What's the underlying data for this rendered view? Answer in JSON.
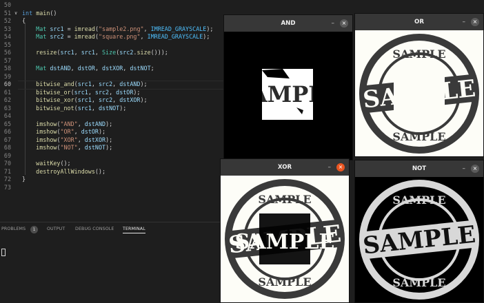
{
  "editor": {
    "lines": [
      {
        "n": "50",
        "parts": []
      },
      {
        "n": "51",
        "fold": "∨",
        "parts": [
          {
            "t": "int",
            "c": "kw"
          },
          {
            "t": " "
          },
          {
            "t": "main",
            "c": "fn"
          },
          {
            "t": "()"
          }
        ]
      },
      {
        "n": "52",
        "parts": [
          {
            "t": "{"
          }
        ]
      },
      {
        "n": "53",
        "parts": [
          {
            "t": "    "
          },
          {
            "t": "Mat",
            "c": "ty"
          },
          {
            "t": " "
          },
          {
            "t": "src1",
            "c": "pm"
          },
          {
            "t": " = "
          },
          {
            "t": "imread",
            "c": "fn"
          },
          {
            "t": "("
          },
          {
            "t": "\"sample2.png\"",
            "c": "st"
          },
          {
            "t": ", "
          },
          {
            "t": "IMREAD_GRAYSCALE",
            "c": "cn"
          },
          {
            "t": ");"
          }
        ]
      },
      {
        "n": "54",
        "parts": [
          {
            "t": "    "
          },
          {
            "t": "Mat",
            "c": "ty"
          },
          {
            "t": " "
          },
          {
            "t": "src2",
            "c": "pm"
          },
          {
            "t": " = "
          },
          {
            "t": "imread",
            "c": "fn"
          },
          {
            "t": "("
          },
          {
            "t": "\"square.png\"",
            "c": "st"
          },
          {
            "t": ", "
          },
          {
            "t": "IMREAD_GRAYSCALE",
            "c": "cn"
          },
          {
            "t": ");"
          }
        ]
      },
      {
        "n": "55",
        "parts": []
      },
      {
        "n": "56",
        "parts": [
          {
            "t": "    "
          },
          {
            "t": "resize",
            "c": "fn"
          },
          {
            "t": "("
          },
          {
            "t": "src1",
            "c": "pm"
          },
          {
            "t": ", "
          },
          {
            "t": "src1",
            "c": "pm"
          },
          {
            "t": ", "
          },
          {
            "t": "Size",
            "c": "ty"
          },
          {
            "t": "("
          },
          {
            "t": "src2",
            "c": "pm"
          },
          {
            "t": "."
          },
          {
            "t": "size",
            "c": "fn"
          },
          {
            "t": "()));"
          }
        ]
      },
      {
        "n": "57",
        "parts": []
      },
      {
        "n": "58",
        "parts": [
          {
            "t": "    "
          },
          {
            "t": "Mat",
            "c": "ty"
          },
          {
            "t": " "
          },
          {
            "t": "dstAND",
            "c": "pm"
          },
          {
            "t": ", "
          },
          {
            "t": "dstOR",
            "c": "pm"
          },
          {
            "t": ", "
          },
          {
            "t": "dstXOR",
            "c": "pm"
          },
          {
            "t": ", "
          },
          {
            "t": "dstNOT",
            "c": "pm"
          },
          {
            "t": ";"
          }
        ]
      },
      {
        "n": "59",
        "parts": []
      },
      {
        "n": "60",
        "cur": true,
        "parts": [
          {
            "t": "    "
          },
          {
            "t": "bitwise_and",
            "c": "fn"
          },
          {
            "t": "("
          },
          {
            "t": "src1",
            "c": "pm"
          },
          {
            "t": ", "
          },
          {
            "t": "src2",
            "c": "pm"
          },
          {
            "t": ", "
          },
          {
            "t": "dstAND",
            "c": "pm"
          },
          {
            "t": ");"
          }
        ]
      },
      {
        "n": "61",
        "parts": [
          {
            "t": "    "
          },
          {
            "t": "bitwise_or",
            "c": "fn"
          },
          {
            "t": "("
          },
          {
            "t": "src1",
            "c": "pm"
          },
          {
            "t": ", "
          },
          {
            "t": "src2",
            "c": "pm"
          },
          {
            "t": ", "
          },
          {
            "t": "dstOR",
            "c": "pm"
          },
          {
            "t": ");"
          }
        ]
      },
      {
        "n": "62",
        "parts": [
          {
            "t": "    "
          },
          {
            "t": "bitwise_xor",
            "c": "fn"
          },
          {
            "t": "("
          },
          {
            "t": "src1",
            "c": "pm"
          },
          {
            "t": ", "
          },
          {
            "t": "src2",
            "c": "pm"
          },
          {
            "t": ", "
          },
          {
            "t": "dstXOR",
            "c": "pm"
          },
          {
            "t": ");"
          }
        ]
      },
      {
        "n": "63",
        "parts": [
          {
            "t": "    "
          },
          {
            "t": "bitwise_not",
            "c": "fn"
          },
          {
            "t": "("
          },
          {
            "t": "src1",
            "c": "pm"
          },
          {
            "t": ", "
          },
          {
            "t": "dstNOT",
            "c": "pm"
          },
          {
            "t": ");"
          }
        ]
      },
      {
        "n": "64",
        "parts": []
      },
      {
        "n": "65",
        "parts": [
          {
            "t": "    "
          },
          {
            "t": "imshow",
            "c": "fn"
          },
          {
            "t": "("
          },
          {
            "t": "\"AND\"",
            "c": "st"
          },
          {
            "t": ", "
          },
          {
            "t": "dstAND",
            "c": "pm"
          },
          {
            "t": ");"
          }
        ]
      },
      {
        "n": "66",
        "parts": [
          {
            "t": "    "
          },
          {
            "t": "imshow",
            "c": "fn"
          },
          {
            "t": "("
          },
          {
            "t": "\"OR\"",
            "c": "st"
          },
          {
            "t": ", "
          },
          {
            "t": "dstOR",
            "c": "pm"
          },
          {
            "t": ");"
          }
        ]
      },
      {
        "n": "67",
        "parts": [
          {
            "t": "    "
          },
          {
            "t": "imshow",
            "c": "fn"
          },
          {
            "t": "("
          },
          {
            "t": "\"XOR\"",
            "c": "st"
          },
          {
            "t": ", "
          },
          {
            "t": "dstXOR",
            "c": "pm"
          },
          {
            "t": ");"
          }
        ]
      },
      {
        "n": "68",
        "parts": [
          {
            "t": "    "
          },
          {
            "t": "imshow",
            "c": "fn"
          },
          {
            "t": "("
          },
          {
            "t": "\"NOT\"",
            "c": "st"
          },
          {
            "t": ", "
          },
          {
            "t": "dstNOT",
            "c": "pm"
          },
          {
            "t": ");"
          }
        ]
      },
      {
        "n": "69",
        "parts": []
      },
      {
        "n": "70",
        "parts": [
          {
            "t": "    "
          },
          {
            "t": "waitKey",
            "c": "fn"
          },
          {
            "t": "();"
          }
        ]
      },
      {
        "n": "71",
        "parts": [
          {
            "t": "    "
          },
          {
            "t": "destroyAllWindows",
            "c": "fn"
          },
          {
            "t": "();"
          }
        ]
      },
      {
        "n": "72",
        "parts": [
          {
            "t": "}"
          }
        ]
      },
      {
        "n": "73",
        "parts": []
      }
    ]
  },
  "panel": {
    "tabs": [
      "PROBLEMS",
      "OUTPUT",
      "DEBUG CONSOLE",
      "TERMINAL"
    ],
    "problems_count": "1",
    "active_tab": "TERMINAL"
  },
  "windows": {
    "and": {
      "title": "AND",
      "minimize": "–",
      "close": "×"
    },
    "or": {
      "title": "OR",
      "minimize": "–",
      "close": "×"
    },
    "xor": {
      "title": "XOR",
      "minimize": "–",
      "close": "×"
    },
    "not": {
      "title": "NOT",
      "minimize": "–",
      "close": "×"
    }
  },
  "stamp_text": "SAMPLE",
  "colors": {
    "close_active": "#e95420",
    "titlebar": "#373737",
    "editor_bg": "#1e1e1e"
  }
}
